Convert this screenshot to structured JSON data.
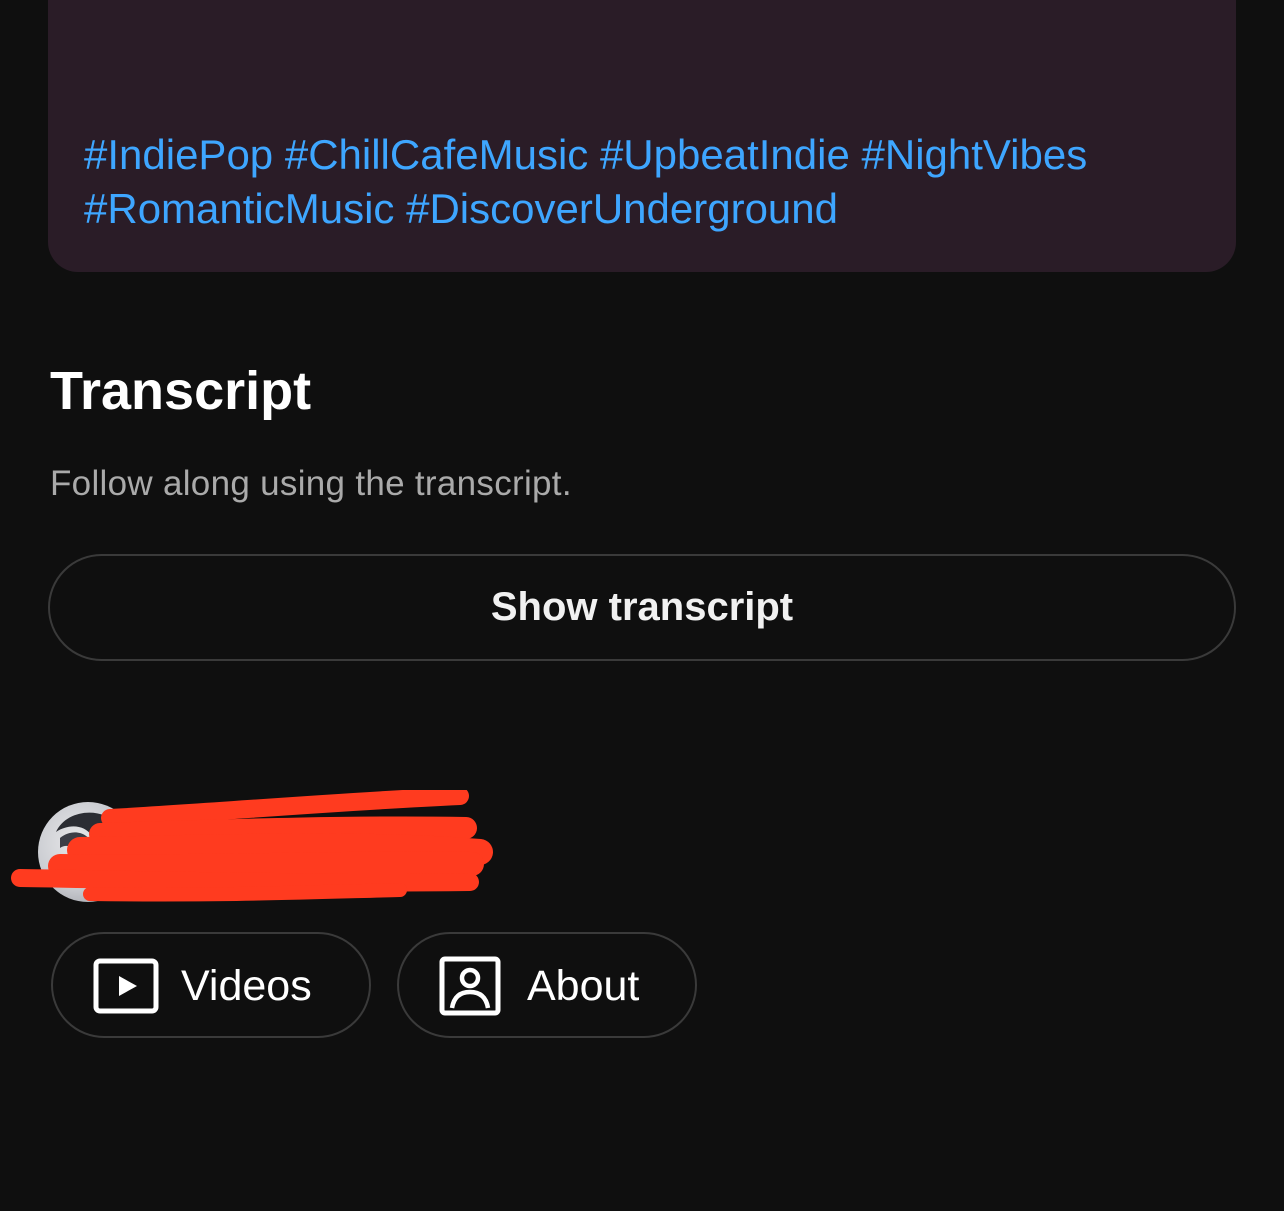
{
  "description": {
    "hashtags": [
      "#IndiePop",
      "#ChillCafeMusic",
      "#UpbeatIndie",
      "#NightVibes",
      "#RomanticMusic",
      "#DiscoverUnderground"
    ]
  },
  "transcript": {
    "title": "Transcript",
    "subtitle": "Follow along using the transcript.",
    "show_button_label": "Show transcript"
  },
  "channel": {
    "avatar_icon": "channel-avatar",
    "name_redacted": true
  },
  "channel_buttons": {
    "videos_label": "Videos",
    "videos_icon": "play-square-icon",
    "about_label": "About",
    "about_icon": "person-square-icon"
  },
  "colors": {
    "background": "#0f0f0f",
    "card_background": "#2a1c27",
    "hashtag": "#3ea6ff",
    "subtitle_text": "#aaaaaa",
    "button_border": "#3a3a3a",
    "redaction": "#ff3b1f"
  }
}
